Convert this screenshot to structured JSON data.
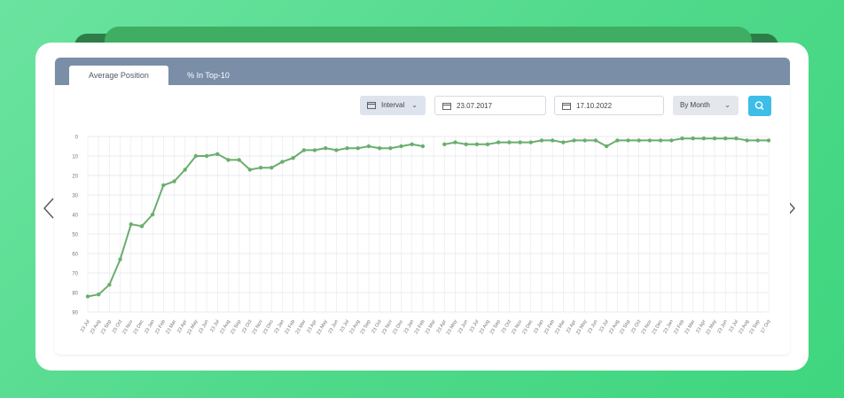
{
  "tabs": [
    {
      "label": "Average Position",
      "active": true
    },
    {
      "label": "% In Top-10",
      "active": false
    }
  ],
  "controls": {
    "interval_label": "Interval",
    "date_from": "23.07.2017",
    "date_to": "17.10.2022",
    "group_by": "By Month"
  },
  "icons": {
    "calendar": "calendar-icon",
    "dropdown": "chevron-down-icon",
    "search": "search-icon",
    "prev": "chevron-left-icon",
    "next": "chevron-right-icon"
  },
  "colors": {
    "line": "#6aae6e",
    "tabbar": "#7a8ea7",
    "search": "#3dbde8"
  },
  "chart_data": {
    "type": "line",
    "title": "",
    "xlabel": "",
    "ylabel": "",
    "ylim": [
      0,
      90
    ],
    "y_inverted": true,
    "yticks": [
      "0",
      "10",
      "20",
      "30",
      "40",
      "50",
      "60",
      "70",
      "80",
      "90"
    ],
    "grid": true,
    "categories": [
      "23 Jul",
      "23 Aug",
      "23 Sep",
      "23 Oct",
      "23 Nov",
      "23 Dec",
      "23 Jan",
      "23 Feb",
      "23 Mar",
      "23 Apr",
      "23 May",
      "23 Jun",
      "23 Jul",
      "23 Aug",
      "23 Sep",
      "23 Oct",
      "23 Nov",
      "23 Dec",
      "23 Jan",
      "23 Feb",
      "23 Mar",
      "23 Apr",
      "23 May",
      "23 Jun",
      "23 Jul",
      "23 Aug",
      "23 Sep",
      "23 Oct",
      "23 Nov",
      "23 Dec",
      "23 Jan",
      "23 Feb",
      "23 Mar",
      "23 Apr",
      "23 May",
      "23 Jun",
      "23 Jul",
      "23 Aug",
      "23 Sep",
      "23 Oct",
      "23 Nov",
      "23 Dec",
      "23 Jan",
      "23 Feb",
      "23 Mar",
      "23 Apr",
      "23 May",
      "23 Jun",
      "23 Jul",
      "23 Aug",
      "23 Sep",
      "23 Oct",
      "23 Nov",
      "23 Dec",
      "23 Jan",
      "23 Feb",
      "23 Mar",
      "23 Apr",
      "23 May",
      "23 Jun",
      "23 Jul",
      "23 Aug",
      "23 Sep",
      "17 Oct"
    ],
    "series": [
      {
        "values": [
          82,
          81,
          76,
          63,
          45,
          46,
          40,
          25,
          23,
          17,
          10,
          10,
          9,
          12,
          12,
          17,
          16,
          16,
          13,
          11,
          7,
          7,
          6,
          7,
          6,
          6,
          5,
          6,
          6,
          5,
          4,
          5,
          null,
          4,
          3,
          4,
          4,
          4,
          3,
          3,
          3,
          3,
          2,
          2,
          3,
          2,
          2,
          2,
          5,
          2,
          2,
          2,
          2,
          2,
          2,
          1,
          1,
          1,
          1,
          1,
          1,
          2,
          2,
          2
        ]
      }
    ]
  }
}
